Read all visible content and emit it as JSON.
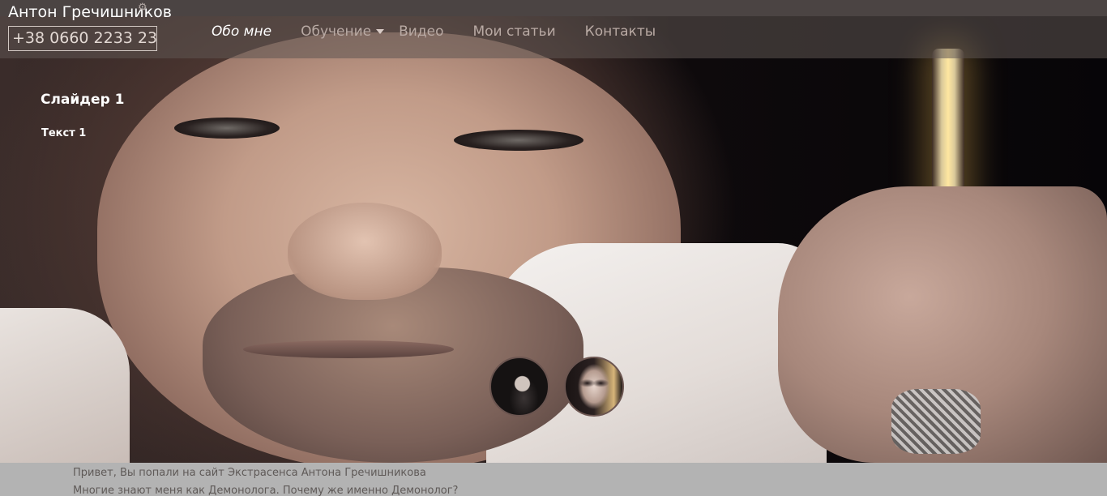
{
  "header": {
    "site_title": "Антон Гречишников",
    "phone": "+38 0660 2233 23",
    "nav": [
      {
        "label": "Обо мне",
        "active": true
      },
      {
        "label": "Обучение",
        "has_dropdown": true
      },
      {
        "label": "Видео"
      },
      {
        "label": "Мои статьи"
      },
      {
        "label": "Контакты"
      }
    ]
  },
  "slider": {
    "title": "Слайдер 1",
    "text": "Текст 1",
    "thumbnails": 2
  },
  "content": {
    "lines": [
      "Привет, Вы попали на сайт Экстрасенса Антона Гречишникова",
      "Многие знают меня как Демонолога. Почему же именно Демонолог?"
    ]
  },
  "colors": {
    "topbar": "#4b4443",
    "nav_active": "#ffffff",
    "nav_inactive": "#b9aaa4",
    "content_bg": "#b3b3b3",
    "content_text": "#5f5a58"
  },
  "icons": [
    "gear-icon",
    "caret-down-icon"
  ]
}
